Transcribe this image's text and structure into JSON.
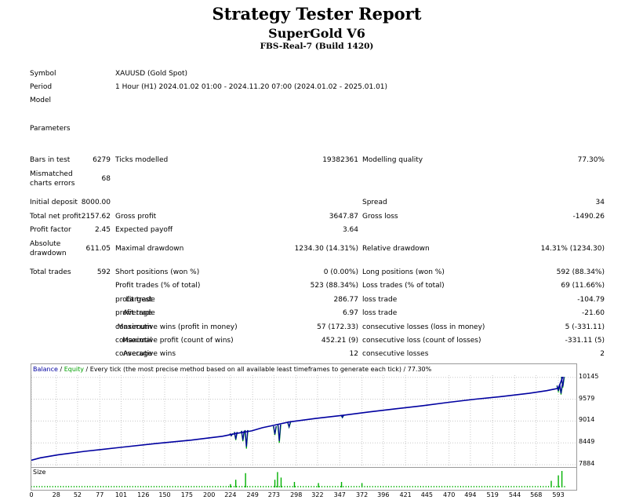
{
  "header": {
    "title": "Strategy Tester Report",
    "ea_name": "SuperGold V6",
    "server": "FBS-Real-7 (Build 1420)"
  },
  "info": {
    "symbol_label": "Symbol",
    "symbol_value": "XAUUSD (Gold Spot)",
    "period_label": "Period",
    "period_value": "1 Hour (H1) 2024.01.02 01:00 - 2024.11.20 07:00 (2024.01.02 - 2025.01.01)",
    "model_label": "Model",
    "parameters_label": "Parameters"
  },
  "stats": {
    "bars_label": "Bars in test",
    "bars_value": "6279",
    "ticks_label": "Ticks modelled",
    "ticks_value": "19382361",
    "quality_label": "Modelling quality",
    "quality_value": "77.30%",
    "mismatched_label_1": "Mismatched",
    "mismatched_label_2": "charts errors",
    "mismatched_value": "68",
    "deposit_label": "Initial deposit",
    "deposit_value": "8000.00",
    "spread_label": "Spread",
    "spread_value": "34",
    "net_profit_label": "Total net profit",
    "net_profit_value": "2157.62",
    "gross_profit_label": "Gross profit",
    "gross_profit_value": "3647.87",
    "gross_loss_label": "Gross loss",
    "gross_loss_value": "-1490.26",
    "profit_factor_label": "Profit factor",
    "profit_factor_value": "2.45",
    "expected_payoff_label": "Expected payoff",
    "expected_payoff_value": "3.64",
    "abs_dd_label_1": "Absolute",
    "abs_dd_label_2": "drawdown",
    "abs_dd_value": "611.05",
    "max_dd_label": "Maximal drawdown",
    "max_dd_value": "1234.30 (14.31%)",
    "rel_dd_label": "Relative drawdown",
    "rel_dd_value": "14.31% (1234.30)",
    "total_trades_label": "Total trades",
    "total_trades_value": "592",
    "short_label": "Short positions (won %)",
    "short_value": "0 (0.00%)",
    "long_label": "Long positions (won %)",
    "long_value": "592 (88.34%)",
    "profit_trades_label": "Profit trades (% of total)",
    "profit_trades_value": "523 (88.34%)",
    "loss_trades_label": "Loss trades (% of total)",
    "loss_trades_value": "69 (11.66%)",
    "largest_label": "Largest",
    "largest_profit_label": "profit trade",
    "largest_profit_value": "286.77",
    "largest_loss_label": "loss trade",
    "largest_loss_value": "-104.79",
    "average_label": "Average",
    "average_profit_label": "profit trade",
    "average_profit_value": "6.97",
    "average_loss_label": "loss trade",
    "average_loss_value": "-21.60",
    "maximum_label": "Maximum",
    "max_cons_wins_label": "consecutive wins (profit in money)",
    "max_cons_wins_value": "57 (172.33)",
    "max_cons_losses_label": "consecutive losses (loss in money)",
    "max_cons_losses_value": "5 (-331.11)",
    "maximal_label": "Maximal",
    "maximal_cons_profit_label": "consecutive profit (count of wins)",
    "maximal_cons_profit_value": "452.21 (9)",
    "maximal_cons_loss_label": "consecutive loss (count of losses)",
    "maximal_cons_loss_value": "-331.11 (5)",
    "avg_label": "Average",
    "avg_cons_wins_label": "consecutive wins",
    "avg_cons_wins_value": "12",
    "avg_cons_losses_label": "consecutive losses",
    "avg_cons_losses_value": "2"
  },
  "chart_data": {
    "type": "line",
    "legend_balance": "Balance",
    "legend_equity": "Equity",
    "legend_sep": " / ",
    "subtitle": " / Every tick (the most precise method based on all available least timeframes to generate each tick) / 77.30%",
    "size_label": "Size",
    "colors": {
      "balance": "#0000a0",
      "equity": "#00b000",
      "size": "#00b000",
      "grid": "#c8c8c8"
    },
    "ylim": [
      7884,
      10200
    ],
    "xlim": [
      0,
      600
    ],
    "y_ticks": [
      "10145",
      "9579",
      "9014",
      "8449",
      "7884"
    ],
    "x_ticks": [
      "0",
      "28",
      "52",
      "77",
      "101",
      "126",
      "150",
      "175",
      "200",
      "224",
      "249",
      "273",
      "298",
      "322",
      "347",
      "372",
      "396",
      "421",
      "445",
      "470",
      "494",
      "519",
      "544",
      "568",
      "593"
    ],
    "balance": [
      [
        0,
        8000
      ],
      [
        10,
        8060
      ],
      [
        30,
        8140
      ],
      [
        60,
        8230
      ],
      [
        100,
        8330
      ],
      [
        140,
        8430
      ],
      [
        180,
        8520
      ],
      [
        215,
        8620
      ],
      [
        230,
        8690
      ],
      [
        248,
        8760
      ],
      [
        260,
        8840
      ],
      [
        272,
        8900
      ],
      [
        290,
        8990
      ],
      [
        320,
        9080
      ],
      [
        350,
        9160
      ],
      [
        380,
        9250
      ],
      [
        410,
        9330
      ],
      [
        440,
        9410
      ],
      [
        470,
        9500
      ],
      [
        500,
        9580
      ],
      [
        530,
        9650
      ],
      [
        560,
        9730
      ],
      [
        580,
        9800
      ],
      [
        593,
        9860
      ],
      [
        598,
        10157
      ]
    ],
    "equity_dips": [
      [
        225,
        8690,
        8630
      ],
      [
        230,
        8730,
        8520
      ],
      [
        238,
        8760,
        8490
      ],
      [
        242,
        8780,
        8300
      ],
      [
        274,
        8880,
        8650
      ],
      [
        279,
        8920,
        8450
      ],
      [
        290,
        8980,
        8850
      ],
      [
        350,
        9170,
        9100
      ],
      [
        593,
        9930,
        9780
      ],
      [
        596,
        9960,
        9700
      ],
      [
        598,
        10157,
        9880
      ]
    ],
    "size_spikes": [
      [
        224,
        3
      ],
      [
        230,
        7
      ],
      [
        241,
        13
      ],
      [
        274,
        7
      ],
      [
        277,
        14
      ],
      [
        281,
        9
      ],
      [
        296,
        5
      ],
      [
        323,
        4
      ],
      [
        349,
        5
      ],
      [
        372,
        4
      ],
      [
        585,
        6
      ],
      [
        593,
        11
      ],
      [
        597,
        15
      ]
    ]
  }
}
